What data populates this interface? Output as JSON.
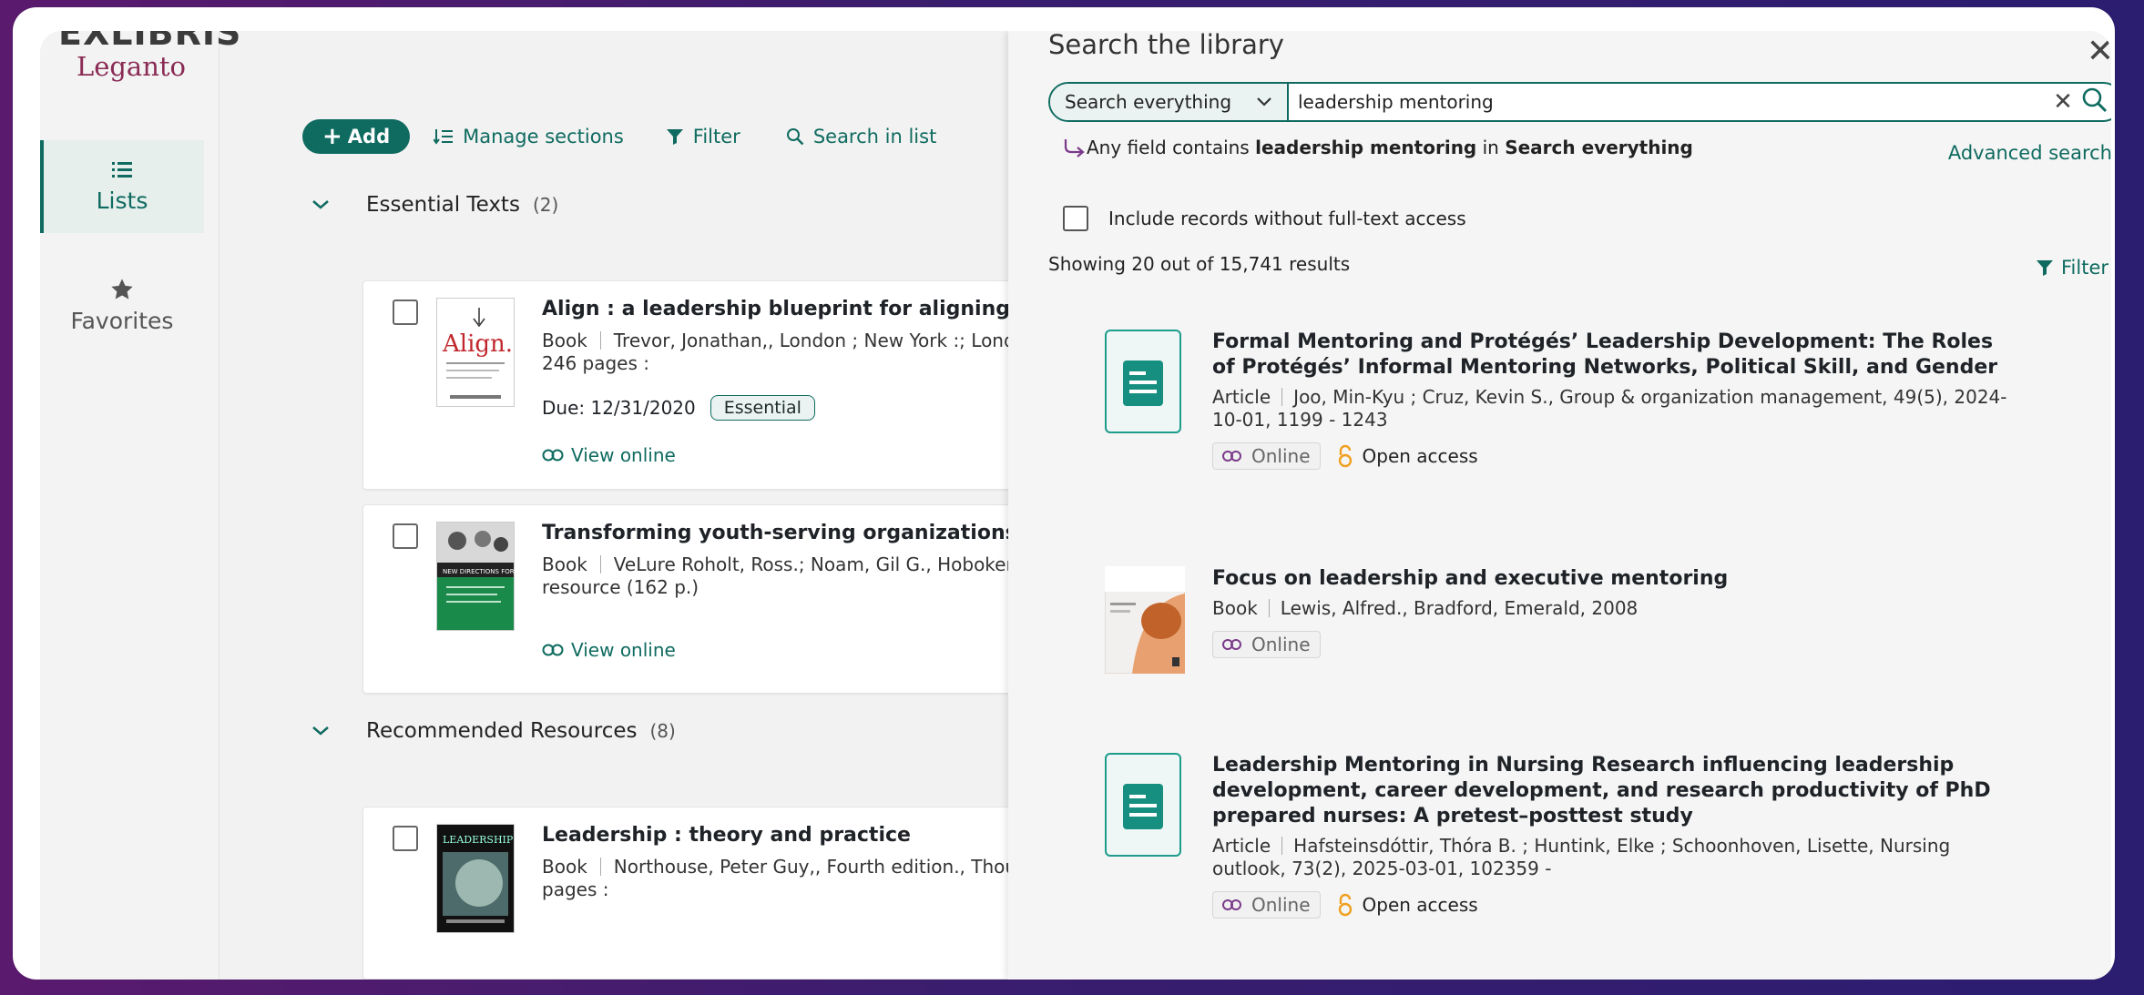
{
  "brand": {
    "top": "EXLIBRIS",
    "product": "Leganto"
  },
  "nav": {
    "lists": "Lists",
    "favorites": "Favorites"
  },
  "toolbar": {
    "add": "Add",
    "manage": "Manage sections",
    "filter": "Filter",
    "search": "Search in list"
  },
  "sections": [
    {
      "title": "Essential Texts",
      "count": "(2)"
    },
    {
      "title": "Recommended Resources",
      "count": "(8)"
    }
  ],
  "items": [
    {
      "title": "Align : a leadership blueprint for aligning enter",
      "type": "Book",
      "meta1": "Trevor, Jonathan,, London ; New York :; Lond",
      "meta2": "246 pages :",
      "due": "Due: 12/31/2020",
      "tag": "Essential",
      "link": "View online"
    },
    {
      "title": "Transforming youth-serving organizations to s",
      "type": "Book",
      "meta1": "VeLure Roholt, Ross.; Noam, Gil G., Hoboken",
      "meta2": "resource (162 p.)",
      "link": "View online"
    },
    {
      "title": "Leadership : theory and practice",
      "type": "Book",
      "meta1": "Northouse, Peter Guy,, Fourth edition., Thou",
      "meta2": "pages :"
    }
  ],
  "drawer": {
    "title": "Search the library",
    "scope": "Search everything",
    "query": "leadership mentoring",
    "desc_prefix": "Any field contains",
    "desc_term": "leadership mentoring",
    "desc_in": "in",
    "desc_scope": "Search everything",
    "advanced": "Advanced search",
    "include": "Include records without full-text access",
    "showing": "Showing 20 out of 15,741 results",
    "filter": "Filter"
  },
  "results": [
    {
      "title": "Formal Mentoring and Protégés’ Leadership Development: The Roles of Protégés’ Informal Mentoring Networks, Political Skill, and Gender",
      "type": "Article",
      "meta": "Joo, Min-Kyu ; Cruz, Kevin S., Group & organization management, 49(5), 2024-10-01, 1199 - 1243",
      "online": "Online",
      "oa": "Open access"
    },
    {
      "title": "Focus on leadership and executive mentoring",
      "type": "Book",
      "meta": "Lewis, Alfred., Bradford, Emerald, 2008",
      "online": "Online"
    },
    {
      "title": "Leadership Mentoring in Nursing Research influencing leadership development, career development, and research productivity of PhD prepared nurses: A pretest–posttest study",
      "type": "Article",
      "meta": "Hafsteinsdóttir, Thóra B. ; Huntink, Elke ; Schoonhoven, Lisette, Nursing outlook, 73(2), 2025-03-01, 102359 -",
      "online": "Online",
      "oa": "Open access"
    }
  ],
  "colors": {
    "accent": "#0f6b60",
    "brand": "#8a2b55",
    "oa": "#f0a020",
    "link_icon": "#7a3a8a"
  }
}
